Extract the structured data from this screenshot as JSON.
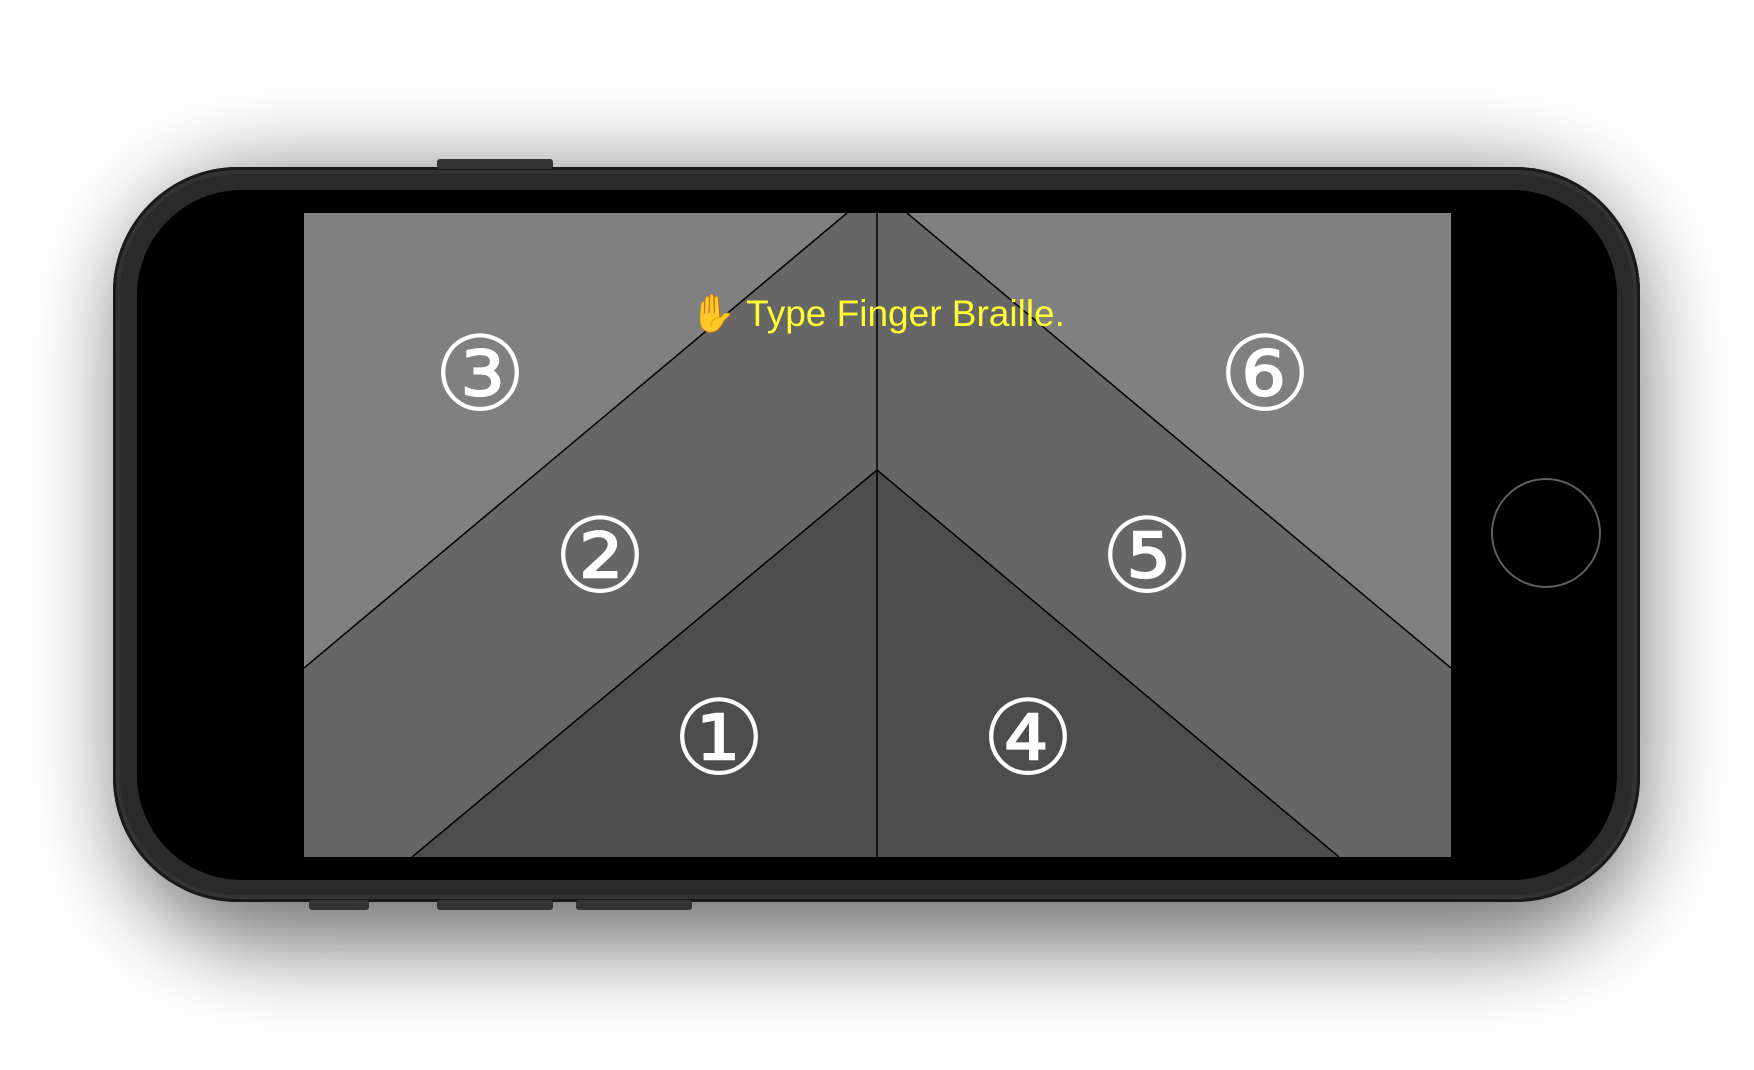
{
  "instruction": {
    "icon": "raised-hand-icon",
    "hand_glyph": "✋",
    "text": "Type Finger Braille."
  },
  "dots": [
    {
      "id": 1,
      "label": "①"
    },
    {
      "id": 2,
      "label": "②"
    },
    {
      "id": 3,
      "label": "③"
    },
    {
      "id": 4,
      "label": "④"
    },
    {
      "id": 5,
      "label": "⑤"
    },
    {
      "id": 6,
      "label": "⑥"
    }
  ],
  "colors": {
    "outer_zone": "#808080",
    "middle_zone": "#666666",
    "inner_zone": "#4d4d4d",
    "divider": "#000000",
    "instruction_text": "#ffff33",
    "dot_label": "#ffffff",
    "phone_bezel": "#000000"
  }
}
